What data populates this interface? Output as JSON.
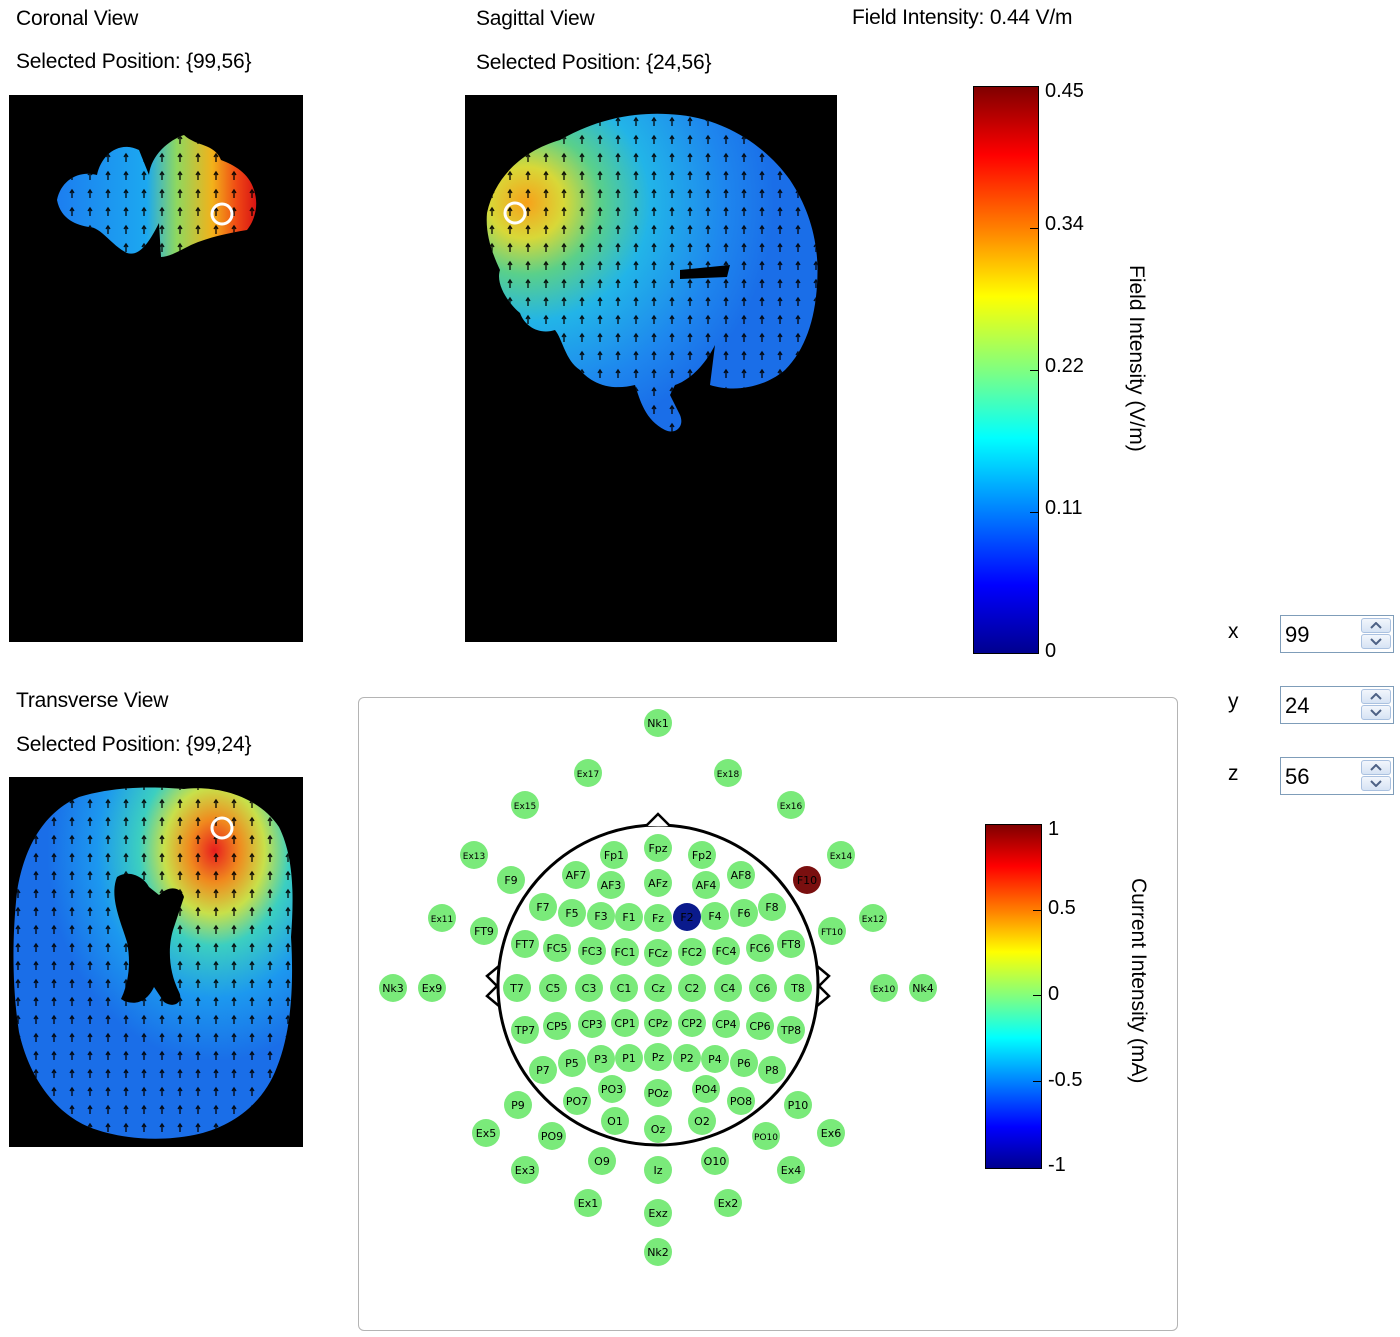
{
  "coronal": {
    "title": "Coronal View",
    "position": "Selected Position: {99,56}"
  },
  "sagittal": {
    "title": "Sagittal View",
    "position": "Selected Position: {24,56}"
  },
  "transverse": {
    "title": "Transverse View",
    "position": "Selected Position: {99,24}"
  },
  "field_readout": "Field Intensity: 0.44 V/m",
  "field_colorbar": {
    "title": "Field Intensity (V/m)",
    "ticks": [
      "0.45",
      "0.34",
      "0.22",
      "0.11",
      "0"
    ]
  },
  "current_colorbar": {
    "title": "Current Intensity (mA)",
    "ticks": [
      "1",
      "0.5",
      "0",
      "-0.5",
      "-1"
    ]
  },
  "coords": {
    "x": {
      "label": "x",
      "value": "99"
    },
    "y": {
      "label": "y",
      "value": "24"
    },
    "z": {
      "label": "z",
      "value": "56"
    }
  },
  "colors": {
    "electrode_default": "#7aea7a",
    "electrode_anode": "#7a0f0f",
    "electrode_cathode": "#0a1a8c"
  },
  "icons": [
    "spin-up-icon",
    "spin-down-icon",
    "selection-marker-icon"
  ],
  "electrodes": [
    {
      "name": "Nk1"
    },
    {
      "name": "Ex17"
    },
    {
      "name": "Ex18"
    },
    {
      "name": "Ex15"
    },
    {
      "name": "Ex16"
    },
    {
      "name": "Ex13"
    },
    {
      "name": "Fpz"
    },
    {
      "name": "Ex14"
    },
    {
      "name": "Fp1"
    },
    {
      "name": "Fp2"
    },
    {
      "name": "F9"
    },
    {
      "name": "AF7"
    },
    {
      "name": "AFz"
    },
    {
      "name": "AF8"
    },
    {
      "name": "F10",
      "state": "anode"
    },
    {
      "name": "AF3"
    },
    {
      "name": "AF4"
    },
    {
      "name": "F7"
    },
    {
      "name": "F8"
    },
    {
      "name": "F5"
    },
    {
      "name": "F3"
    },
    {
      "name": "F1"
    },
    {
      "name": "Fz"
    },
    {
      "name": "F2",
      "state": "cathode"
    },
    {
      "name": "F4"
    },
    {
      "name": "F6"
    },
    {
      "name": "Ex11"
    },
    {
      "name": "Ex12"
    },
    {
      "name": "FT9"
    },
    {
      "name": "FT10"
    },
    {
      "name": "FT7"
    },
    {
      "name": "FC5"
    },
    {
      "name": "FC3"
    },
    {
      "name": "FC1"
    },
    {
      "name": "FCz"
    },
    {
      "name": "FC2"
    },
    {
      "name": "FC4"
    },
    {
      "name": "FC6"
    },
    {
      "name": "FT8"
    },
    {
      "name": "Nk3"
    },
    {
      "name": "Ex9"
    },
    {
      "name": "T7"
    },
    {
      "name": "C5"
    },
    {
      "name": "C3"
    },
    {
      "name": "C1"
    },
    {
      "name": "Cz"
    },
    {
      "name": "C2"
    },
    {
      "name": "C4"
    },
    {
      "name": "C6"
    },
    {
      "name": "T8"
    },
    {
      "name": "Ex10"
    },
    {
      "name": "Nk4"
    },
    {
      "name": "TP7"
    },
    {
      "name": "CP5"
    },
    {
      "name": "CP3"
    },
    {
      "name": "CP1"
    },
    {
      "name": "CPz"
    },
    {
      "name": "CP2"
    },
    {
      "name": "CP4"
    },
    {
      "name": "CP6"
    },
    {
      "name": "TP8"
    },
    {
      "name": "P7"
    },
    {
      "name": "P5"
    },
    {
      "name": "P3"
    },
    {
      "name": "P1"
    },
    {
      "name": "Pz"
    },
    {
      "name": "P2"
    },
    {
      "name": "P4"
    },
    {
      "name": "P6"
    },
    {
      "name": "P8"
    },
    {
      "name": "P9"
    },
    {
      "name": "P10"
    },
    {
      "name": "PO7"
    },
    {
      "name": "PO3"
    },
    {
      "name": "POz"
    },
    {
      "name": "PO4"
    },
    {
      "name": "PO8"
    },
    {
      "name": "Ex5"
    },
    {
      "name": "Ex6"
    },
    {
      "name": "PO9"
    },
    {
      "name": "O1"
    },
    {
      "name": "O2"
    },
    {
      "name": "PO10"
    },
    {
      "name": "Oz"
    },
    {
      "name": "O9"
    },
    {
      "name": "O10"
    },
    {
      "name": "Ex3"
    },
    {
      "name": "Ex4"
    },
    {
      "name": "Iz"
    },
    {
      "name": "Ex1"
    },
    {
      "name": "Ex2"
    },
    {
      "name": "Exz"
    },
    {
      "name": "Nk2"
    }
  ]
}
